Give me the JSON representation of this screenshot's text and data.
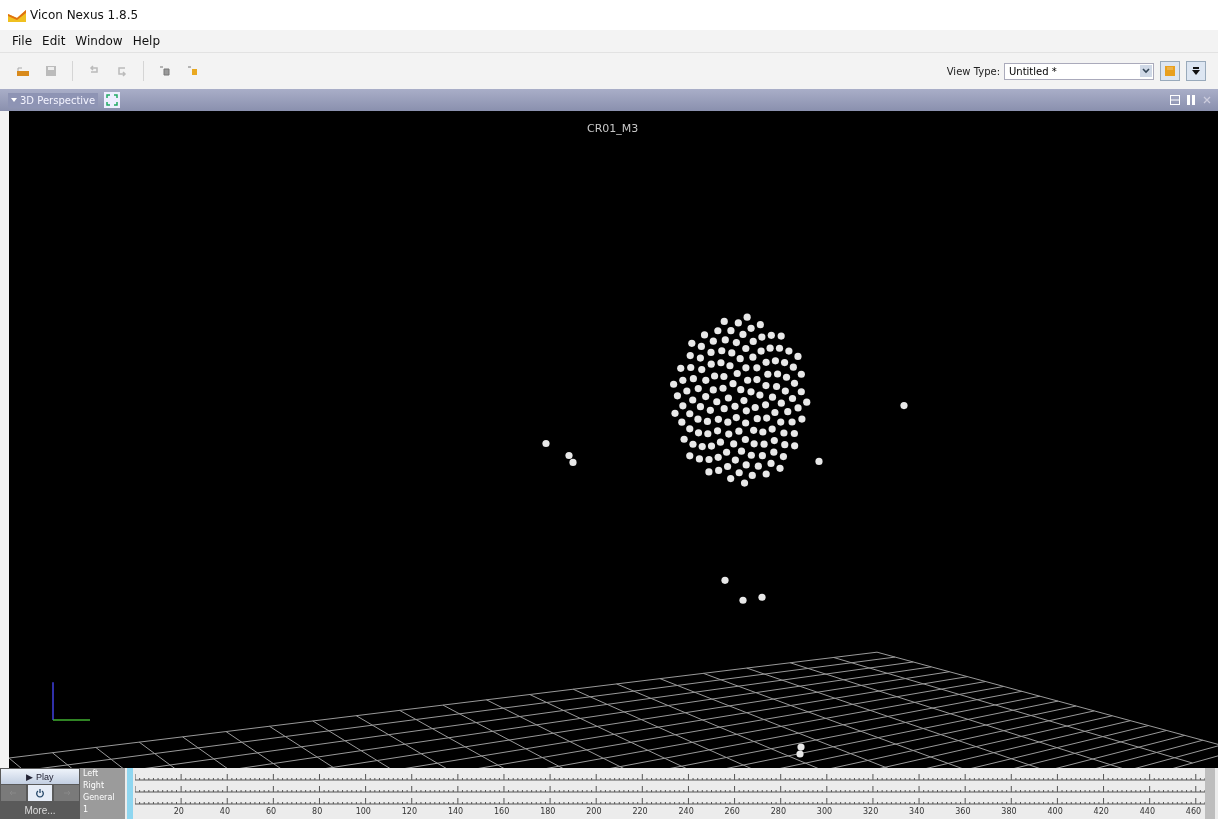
{
  "window": {
    "title": "Vicon Nexus 1.8.5"
  },
  "menu": [
    "File",
    "Edit",
    "Window",
    "Help"
  ],
  "toolbar": {
    "view_type_label": "View Type:",
    "view_type_value": "Untitled *"
  },
  "view": {
    "tab_label": "3D Perspective",
    "subject": "CR01_M3"
  },
  "timeline": {
    "play_label": "▶ Play",
    "more_label": "More...",
    "rows": [
      "Left",
      "Right",
      "General"
    ],
    "start_frame": "1",
    "ticks": [
      "20",
      "40",
      "60",
      "80",
      "100",
      "120",
      "140",
      "160",
      "180",
      "200",
      "220",
      "240",
      "260",
      "280",
      "300",
      "320",
      "340",
      "360",
      "380",
      "400",
      "420",
      "440",
      "460"
    ]
  }
}
